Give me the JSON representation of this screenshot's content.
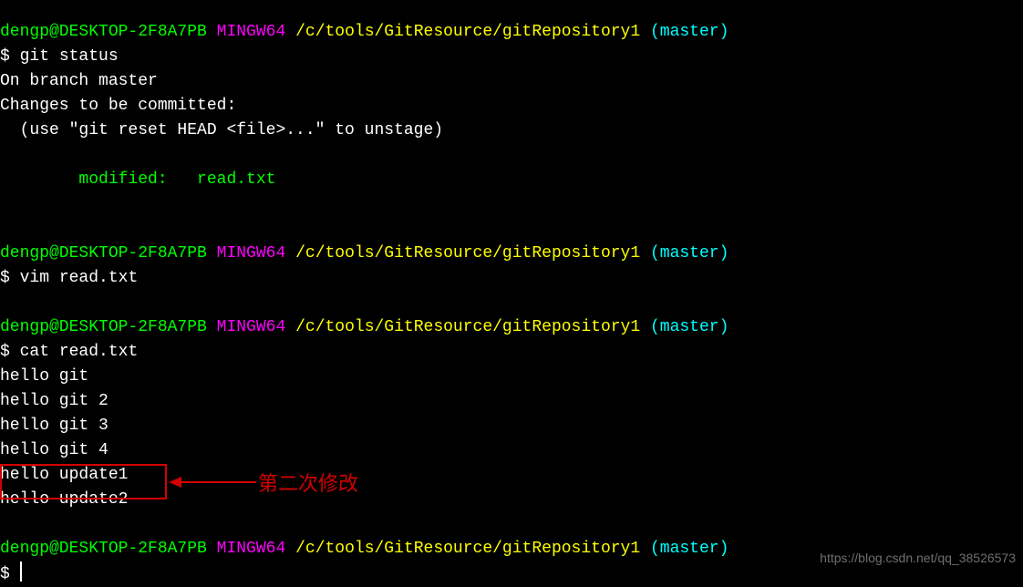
{
  "prompt": {
    "user_host": "dengp@DESKTOP-2F8A7PB",
    "env": "MINGW64",
    "path": "/c/tools/GitResource/gitRepository1",
    "branch": "(master)",
    "symbol": "$"
  },
  "block1": {
    "command": "git status",
    "out_branch": "On branch master",
    "out_changes": "Changes to be committed:",
    "out_hint": "  (use \"git reset HEAD <file>...\" to unstage)",
    "out_modified_indent": "        ",
    "out_modified": "modified:   read.txt"
  },
  "block2": {
    "command": "vim read.txt"
  },
  "block3": {
    "command": "cat read.txt",
    "lines": [
      "hello git",
      "hello git 2",
      "hello git 3",
      "hello git 4",
      "hello update1",
      "hello update2"
    ]
  },
  "annotation": {
    "text": "第二次修改"
  },
  "watermark": "https://blog.csdn.net/qq_38526573"
}
